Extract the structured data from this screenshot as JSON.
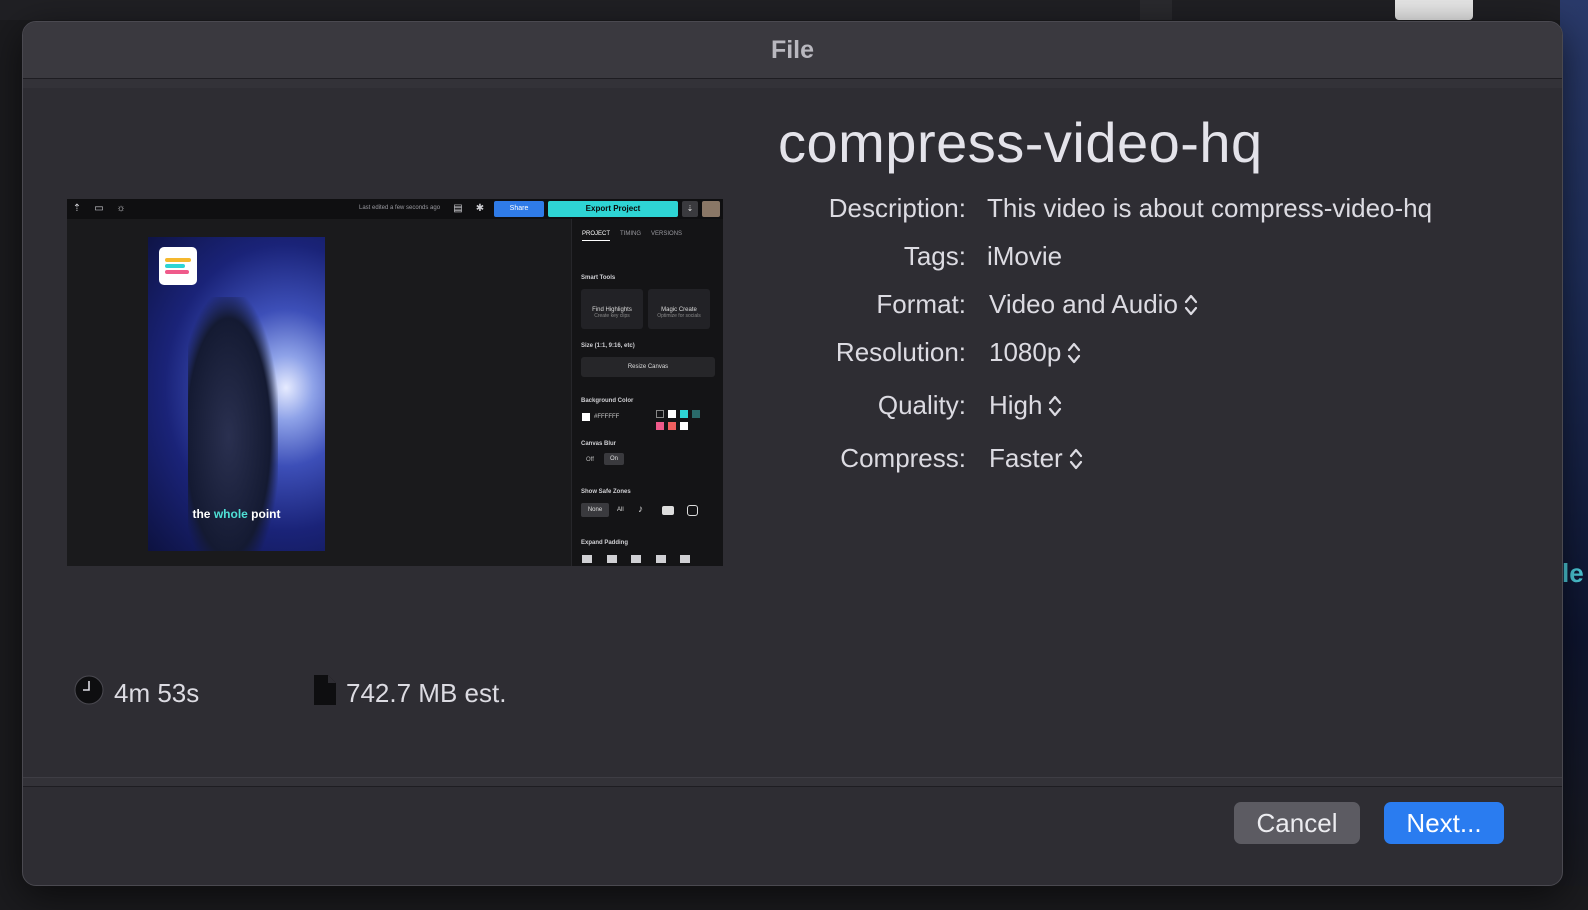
{
  "dialog": {
    "title": "File",
    "file_name": "compress-video-hq",
    "fields": {
      "description_label": "Description:",
      "description_value": "This video is about compress-video-hq",
      "tags_label": "Tags:",
      "tags_value": "iMovie",
      "format_label": "Format:",
      "format_value": "Video and Audio",
      "resolution_label": "Resolution:",
      "resolution_value": "1080p",
      "quality_label": "Quality:",
      "quality_value": "High",
      "compress_label": "Compress:",
      "compress_value": "Faster"
    },
    "stats": {
      "duration": "4m 53s",
      "file_size": "742.7 MB est."
    },
    "buttons": {
      "cancel": "Cancel",
      "next": "Next..."
    }
  },
  "preview": {
    "last_edited": "Last edited a few seconds ago",
    "share": "Share",
    "export": "Export Project",
    "tabs": [
      "PROJECT",
      "TIMING",
      "VERSIONS"
    ],
    "smart_tools": "Smart Tools",
    "find_highlights": "Find Highlights",
    "find_highlights_sub": "Create key clips",
    "magic_create": "Magic Create",
    "magic_create_sub": "Optimize for socials",
    "size_label": "Size (1:1, 9:16, etc)",
    "resize_canvas": "Resize Canvas",
    "bg_color_label": "Background Color",
    "bg_color_value": "#FFFFFF",
    "canvas_blur_label": "Canvas Blur",
    "blur_off": "Off",
    "blur_on": "On",
    "safe_zones_label": "Show Safe Zones",
    "safe_none": "None",
    "safe_all": "All",
    "expand_padding_label": "Expand Padding",
    "caption_pre": "the ",
    "caption_highlight": "whole",
    "caption_post": " point"
  },
  "background": {
    "edge_text": "le"
  },
  "colors": {
    "accent_blue": "#2a7cf0",
    "export_teal": "#2ed4d4",
    "dialog_bg": "#2e2d33"
  }
}
